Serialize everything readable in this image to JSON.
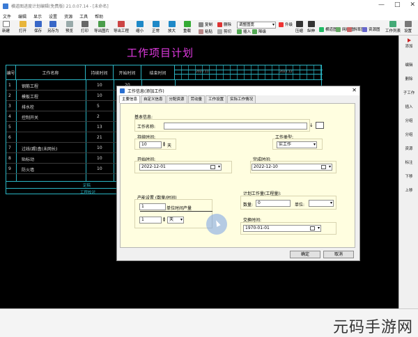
{
  "window": {
    "title": "横道图进度计划编辑(免费版) 21.0.07.14 - [未命名]",
    "min": "—",
    "max": "□",
    "close": "✕"
  },
  "menu": [
    "文件",
    "编辑",
    "显示",
    "设置",
    "资源",
    "工具",
    "帮助"
  ],
  "toolbar": {
    "items": [
      "新建",
      "打开",
      "保存",
      "另存为",
      "预览",
      "打印",
      "导出图片",
      "导出工程",
      "缩小",
      "正常",
      "放大",
      "重载"
    ],
    "small": [
      "复制",
      "粘贴",
      "剪切",
      "删除",
      "插入",
      "降级",
      "升级",
      "属性",
      "压缩",
      "伸展",
      "逆序",
      "正序"
    ],
    "zoom_combo": "调整图宽",
    "right": [
      "压缩",
      "纵伸",
      "横道图",
      "网络图",
      "斜率图",
      "资源图",
      "工作列表",
      "设置"
    ]
  },
  "sidebar": [
    "添加",
    "编辑",
    "删除",
    "子工作",
    "插入",
    "分组",
    "分组",
    "资源",
    "标注",
    "下移",
    "上移"
  ],
  "chart": {
    "title": "工作项目计划",
    "headers": [
      "编号",
      "工作名称",
      "持续时间",
      "开始时间",
      "结束时间"
    ],
    "gantt_header": "2022.11",
    "gantt_sub": "2022.12",
    "rows": [
      {
        "id": "1",
        "name": "钢筋工程",
        "dur": "10",
        "start": "20"
      },
      {
        "id": "2",
        "name": "模板工程",
        "dur": "10",
        "start": "20"
      },
      {
        "id": "3",
        "name": "排水栓",
        "dur": "5",
        "start": "20"
      },
      {
        "id": "4",
        "name": "控制开关",
        "dur": "2",
        "start": "20"
      },
      {
        "id": "5",
        "name": "",
        "dur": "13",
        "start": "20"
      },
      {
        "id": "6",
        "name": "",
        "dur": "21",
        "start": "20"
      },
      {
        "id": "7",
        "name": "过线(踢)盒(未网长)",
        "dur": "10",
        "start": "20"
      },
      {
        "id": "8",
        "name": "贴标动",
        "dur": "10",
        "start": "20"
      },
      {
        "id": "9",
        "name": "防火墙",
        "dur": "10",
        "start": "20"
      }
    ],
    "footer1": "定稿",
    "footer2": "工程校对"
  },
  "dialog": {
    "title": "工作信息(添加工作)",
    "close": "✕",
    "tabs": [
      "主要信息",
      "自定义信息",
      "分配资源",
      "劳动量",
      "工作设置",
      "实际工作情况"
    ],
    "basic": "基本信息:",
    "name_label": "工作名称:",
    "name_value": "",
    "dur_label": "持续时间:",
    "dur_value": "10",
    "dur_unit": "天",
    "type_label": "工作类型:",
    "type_value": "实工作",
    "start_label": "开始时间:",
    "start_value": "2022-12-01",
    "end_label": "完成时间:",
    "end_value": "2022-12-10",
    "prod_label": "产能设置 (数量/时间)",
    "prod_value": "1",
    "prod_unit_label": "单位时间产量",
    "prod_time": "1",
    "prod_time_unit": "天",
    "plan_label": "计划工作量(工程量):",
    "qty_label": "数量:",
    "qty_value": "0",
    "unit_label": "单位:",
    "unit_value": "",
    "deliver_label": "交换时间:",
    "deliver_value": "1970-01-01",
    "ok": "确定",
    "cancel": "取消"
  },
  "watermark": "元码手游网"
}
